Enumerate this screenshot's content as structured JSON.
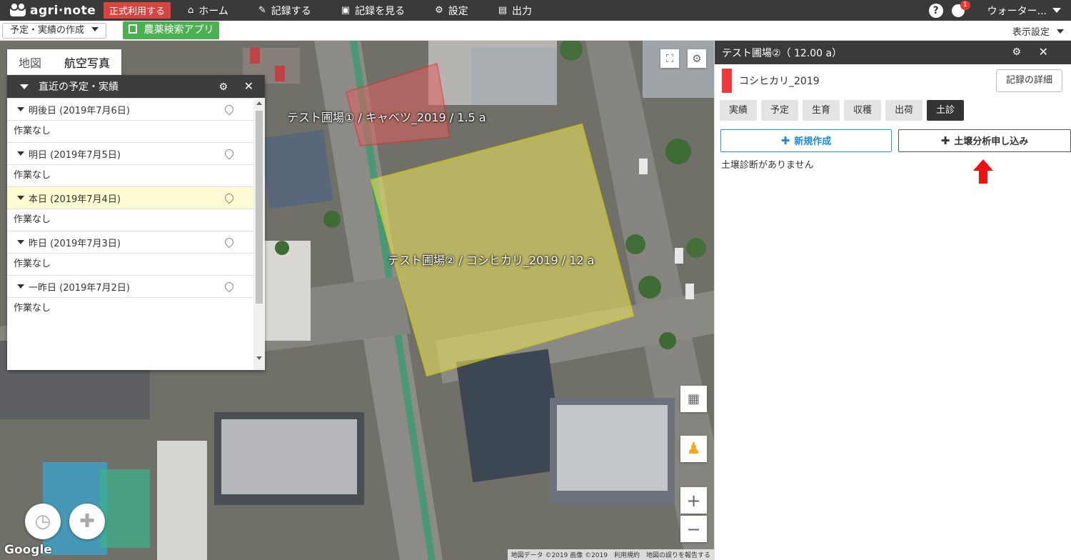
{
  "topnav": {
    "logo": "agri·note",
    "official_badge": "正式利用する",
    "items": [
      {
        "icon": "home-icon",
        "label": "ホーム"
      },
      {
        "icon": "pencil-icon",
        "label": "記録する"
      },
      {
        "icon": "book-icon",
        "label": "記録を見る"
      },
      {
        "icon": "gear-icon",
        "label": "設定"
      },
      {
        "icon": "document-icon",
        "label": "出力"
      }
    ],
    "notification_count": "1",
    "user_name": "ウォーター..."
  },
  "subbar": {
    "plan_button": "予定・実績の作成",
    "pesticide_button": "農薬検索アプリ",
    "display_settings": "表示設定"
  },
  "map": {
    "tabs": [
      "地図",
      "航空写真"
    ],
    "field_labels": [
      "テスト圃場①  /  キャベツ_2019  /  1.5 a",
      "テスト圃場②  /  コシヒカリ_2019  /  12 a"
    ],
    "google": "Google",
    "attribution": "地図データ ©2019 画像 ©2019　利用規約　地図の誤りを報告する"
  },
  "schedule": {
    "title": "直近の予定・実績",
    "days": [
      {
        "label": "明後日 (2019年7月6日)",
        "note": "作業なし"
      },
      {
        "label": "明日 (2019年7月5日)",
        "note": "作業なし"
      },
      {
        "label": "本日 (2019年7月4日)",
        "note": "作業なし"
      },
      {
        "label": "昨日 (2019年7月3日)",
        "note": "作業なし"
      },
      {
        "label": "一昨日 (2019年7月2日)",
        "note": "作業なし"
      }
    ]
  },
  "field_panel": {
    "title": "テスト圃場②（ 12.00 a）",
    "crop_name": "コシヒカリ_2019",
    "crop_color": "#f03a3a",
    "detail_button": "記録の詳細",
    "tabs": [
      "実績",
      "予定",
      "生育",
      "収穫",
      "出荷",
      "土診"
    ],
    "active_tab": "土診",
    "new_button": "新規作成",
    "soil_button": "土壌分析申し込み",
    "empty_message": "土壌診断がありません"
  }
}
